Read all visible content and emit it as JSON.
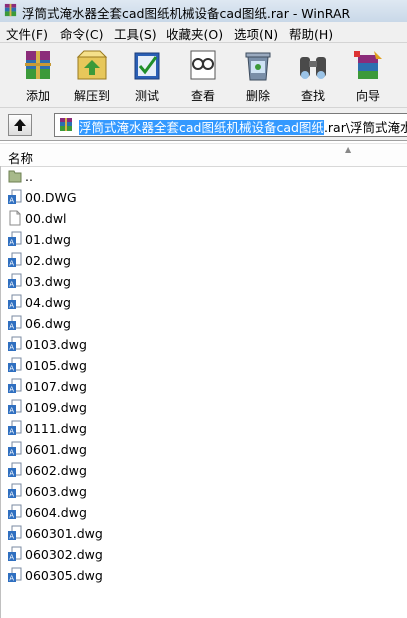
{
  "window": {
    "title": "浮筒式淹水器全套cad图纸机械设备cad图纸.rar - WinRAR"
  },
  "menu": [
    {
      "label": "文件(F)"
    },
    {
      "label": "命令(C)"
    },
    {
      "label": "工具(S)"
    },
    {
      "label": "收藏夹(O)"
    },
    {
      "label": "选项(N)"
    },
    {
      "label": "帮助(H)"
    }
  ],
  "toolbar": [
    {
      "label": "添加",
      "icon": "add-archive-icon"
    },
    {
      "label": "解压到",
      "icon": "extract-to-icon"
    },
    {
      "label": "测试",
      "icon": "test-icon"
    },
    {
      "label": "查看",
      "icon": "view-icon"
    },
    {
      "label": "删除",
      "icon": "delete-icon"
    },
    {
      "label": "查找",
      "icon": "find-icon"
    },
    {
      "label": "向导",
      "icon": "wizard-icon"
    }
  ],
  "address": {
    "selected": "浮筒式淹水器全套cad图纸机械设备cad图纸",
    "rest": ".rar\\浮筒式淹水器"
  },
  "columns": {
    "name": "名称"
  },
  "files": [
    {
      "name": "..",
      "icon": "parent-folder-icon"
    },
    {
      "name": "00.DWG",
      "icon": "dwg-file-icon"
    },
    {
      "name": "00.dwl",
      "icon": "blank-file-icon"
    },
    {
      "name": "01.dwg",
      "icon": "dwg-file-icon"
    },
    {
      "name": "02.dwg",
      "icon": "dwg-file-icon"
    },
    {
      "name": "03.dwg",
      "icon": "dwg-file-icon"
    },
    {
      "name": "04.dwg",
      "icon": "dwg-file-icon"
    },
    {
      "name": "06.dwg",
      "icon": "dwg-file-icon"
    },
    {
      "name": "0103.dwg",
      "icon": "dwg-file-icon"
    },
    {
      "name": "0105.dwg",
      "icon": "dwg-file-icon"
    },
    {
      "name": "0107.dwg",
      "icon": "dwg-file-icon"
    },
    {
      "name": "0109.dwg",
      "icon": "dwg-file-icon"
    },
    {
      "name": "0111.dwg",
      "icon": "dwg-file-icon"
    },
    {
      "name": "0601.dwg",
      "icon": "dwg-file-icon"
    },
    {
      "name": "0602.dwg",
      "icon": "dwg-file-icon"
    },
    {
      "name": "0603.dwg",
      "icon": "dwg-file-icon"
    },
    {
      "name": "0604.dwg",
      "icon": "dwg-file-icon"
    },
    {
      "name": "060301.dwg",
      "icon": "dwg-file-icon"
    },
    {
      "name": "060302.dwg",
      "icon": "dwg-file-icon"
    },
    {
      "name": "060305.dwg",
      "icon": "dwg-file-icon"
    }
  ]
}
